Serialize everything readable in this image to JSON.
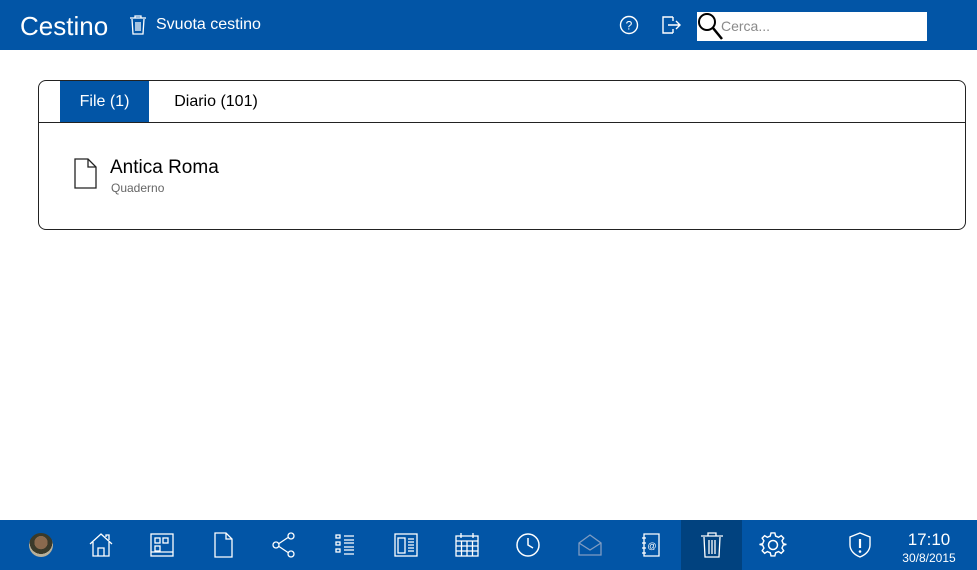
{
  "header": {
    "title": "Cestino",
    "empty_trash_label": "Svuota cestino",
    "search_placeholder": "Cerca...",
    "icons": [
      "help-icon",
      "logout-icon",
      "search-icon"
    ]
  },
  "tabs": [
    {
      "label": "File (1)",
      "active": true
    },
    {
      "label": "Diario (101)",
      "active": false
    }
  ],
  "files": [
    {
      "name": "Antica Roma",
      "type": "Quaderno",
      "icon": "document-icon"
    }
  ],
  "taskbar": {
    "items": [
      "avatar",
      "home-icon",
      "dashboard-icon",
      "document-icon",
      "share-icon",
      "list-icon",
      "notebook-icon",
      "calendar-icon",
      "clock-icon",
      "mail-icon",
      "contacts-icon",
      "trash-icon",
      "settings-icon",
      "shield-icon"
    ],
    "active_item": "trash-icon",
    "time": "17:10",
    "date": "30/8/2015"
  },
  "colors": {
    "brand": "#0255a6",
    "active_taskbar": "#01427f"
  }
}
